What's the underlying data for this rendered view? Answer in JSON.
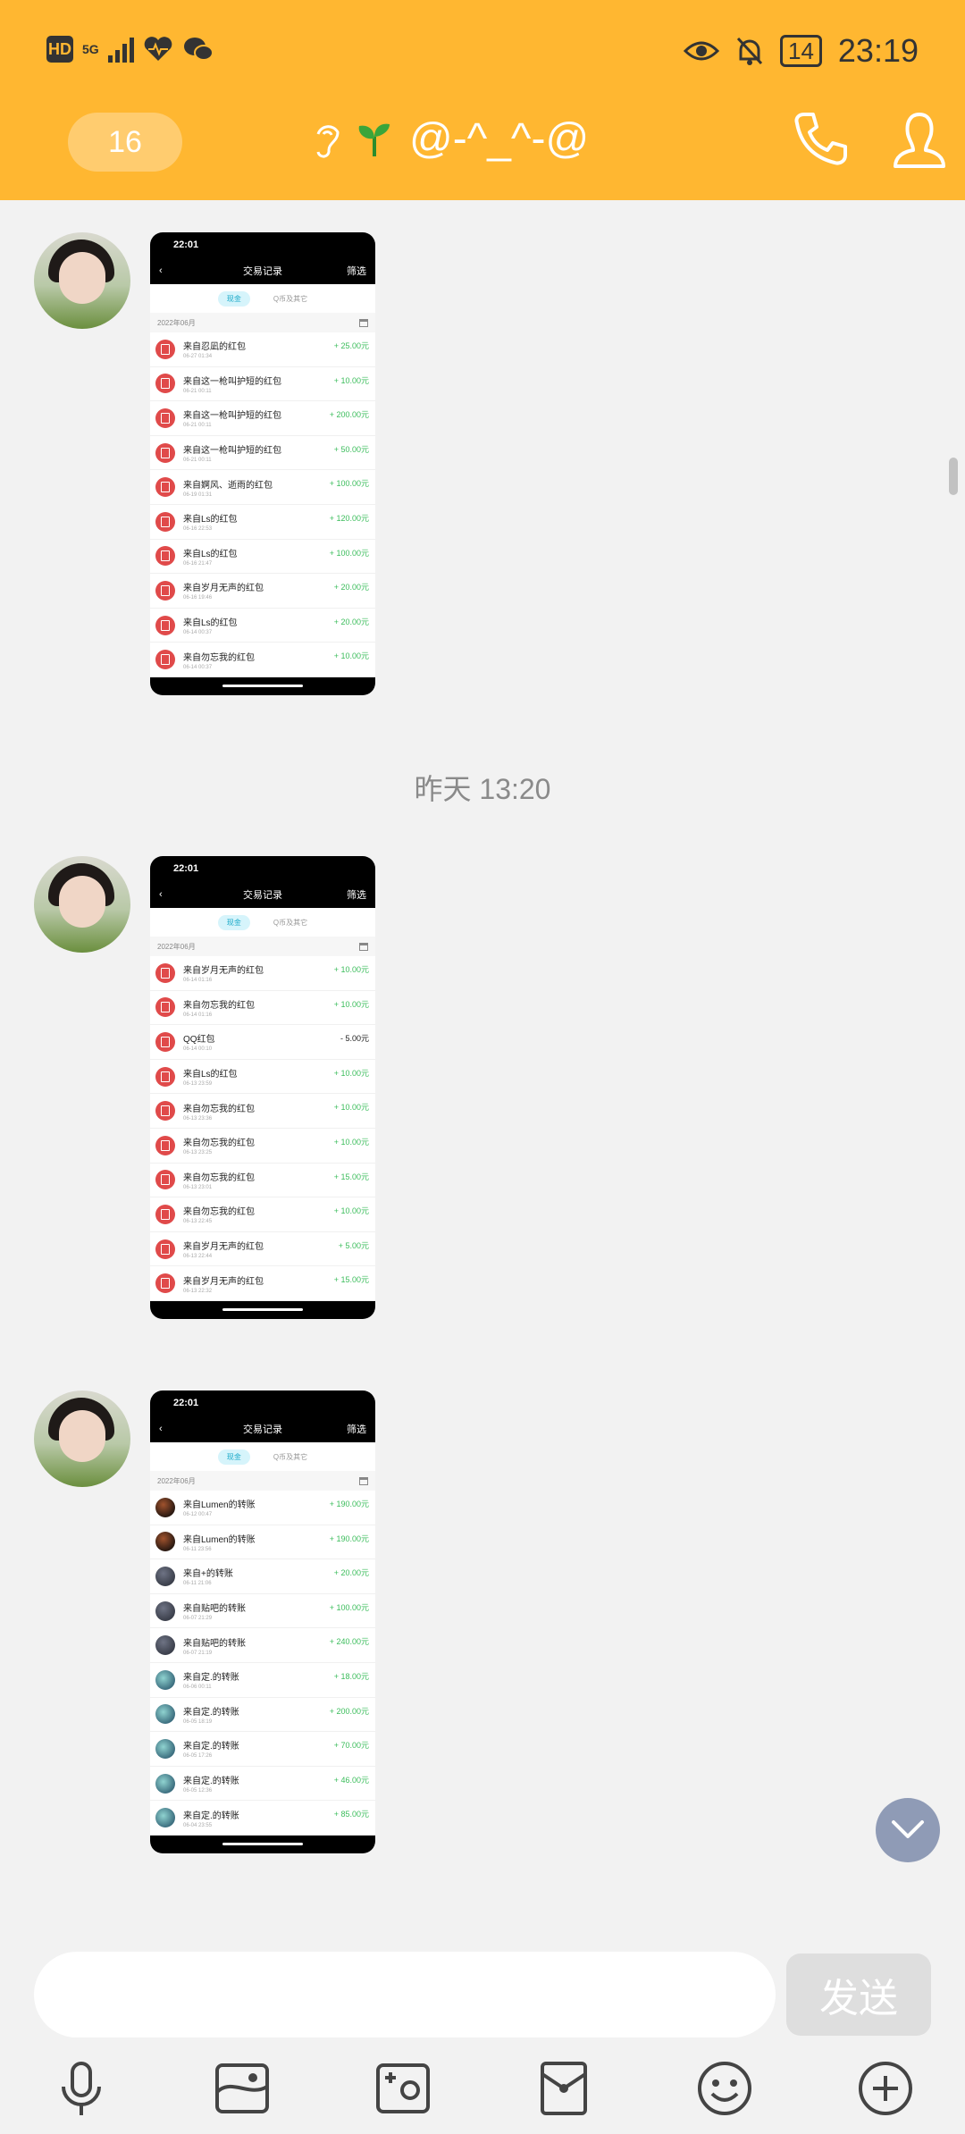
{
  "status_bar": {
    "hd": "HD",
    "network": "5G",
    "battery": "14",
    "time": "23:19"
  },
  "header": {
    "unread_count": "16",
    "contact_name": "@-^_^-@",
    "icons": [
      "ear-icon",
      "sprout-icon",
      "phone-icon",
      "profile-icon"
    ]
  },
  "timestamp": "昨天 13:20",
  "screenshots": [
    {
      "phone_time": "22:01",
      "nav_title": "交易记录",
      "filter": "筛选",
      "tab_active": "现金",
      "tab_other": "Q币及其它",
      "month": "2022年06月",
      "rows": [
        {
          "name": "来自忍凪的红包",
          "date": "06-27 01:34",
          "amount": "+ 25.00元",
          "icon": "red-packet"
        },
        {
          "name": "来自这一枪叫护短的红包",
          "date": "06-21 00:11",
          "amount": "+ 10.00元",
          "icon": "red-packet"
        },
        {
          "name": "来自这一枪叫护短的红包",
          "date": "06-21 00:11",
          "amount": "+ 200.00元",
          "icon": "red-packet"
        },
        {
          "name": "来自这一枪叫护短的红包",
          "date": "06-21 00:11",
          "amount": "+ 50.00元",
          "icon": "red-packet"
        },
        {
          "name": "来自婀风、逝雨的红包",
          "date": "06-19 01:31",
          "amount": "+ 100.00元",
          "icon": "red-packet"
        },
        {
          "name": "来自Ls的红包",
          "date": "06-16 22:53",
          "amount": "+ 120.00元",
          "icon": "red-packet"
        },
        {
          "name": "来自Ls的红包",
          "date": "06-16 21:47",
          "amount": "+ 100.00元",
          "icon": "red-packet"
        },
        {
          "name": "来自岁月无声的红包",
          "date": "06-16 19:46",
          "amount": "+ 20.00元",
          "icon": "red-packet"
        },
        {
          "name": "来自Ls的红包",
          "date": "06-14 00:37",
          "amount": "+ 20.00元",
          "icon": "red-packet"
        },
        {
          "name": "来自勿忘我的红包",
          "date": "06-14 00:37",
          "amount": "+ 10.00元",
          "icon": "red-packet"
        }
      ]
    },
    {
      "phone_time": "22:01",
      "nav_title": "交易记录",
      "filter": "筛选",
      "tab_active": "现金",
      "tab_other": "Q币及其它",
      "month": "2022年06月",
      "rows": [
        {
          "name": "来自岁月无声的红包",
          "date": "06-14 01:16",
          "amount": "+ 10.00元",
          "icon": "red-packet"
        },
        {
          "name": "来自勿忘我的红包",
          "date": "06-14 01:16",
          "amount": "+ 10.00元",
          "icon": "red-packet"
        },
        {
          "name": "QQ红包",
          "date": "06-14 00:10",
          "amount": "- 5.00元",
          "icon": "red-packet",
          "negative": true
        },
        {
          "name": "来自Ls的红包",
          "date": "06-13 23:59",
          "amount": "+ 10.00元",
          "icon": "red-packet"
        },
        {
          "name": "来自勿忘我的红包",
          "date": "06-13 23:36",
          "amount": "+ 10.00元",
          "icon": "red-packet"
        },
        {
          "name": "来自勿忘我的红包",
          "date": "06-13 23:25",
          "amount": "+ 10.00元",
          "icon": "red-packet"
        },
        {
          "name": "来自勿忘我的红包",
          "date": "06-13 23:01",
          "amount": "+ 15.00元",
          "icon": "red-packet"
        },
        {
          "name": "来自勿忘我的红包",
          "date": "06-13 22:45",
          "amount": "+ 10.00元",
          "icon": "red-packet"
        },
        {
          "name": "来自岁月无声的红包",
          "date": "06-13 22:44",
          "amount": "+ 5.00元",
          "icon": "red-packet"
        },
        {
          "name": "来自岁月无声的红包",
          "date": "06-13 22:32",
          "amount": "+ 15.00元",
          "icon": "red-packet"
        }
      ]
    },
    {
      "phone_time": "22:01",
      "nav_title": "交易记录",
      "filter": "筛选",
      "tab_active": "现金",
      "tab_other": "Q币及其它",
      "month": "2022年06月",
      "rows": [
        {
          "name": "来自Lumen的转账",
          "date": "06-12 00:47",
          "amount": "+ 190.00元",
          "icon": "p"
        },
        {
          "name": "来自Lumen的转账",
          "date": "06-11 23:56",
          "amount": "+ 190.00元",
          "icon": "p"
        },
        {
          "name": "来自+的转账",
          "date": "06-11 21:06",
          "amount": "+ 20.00元",
          "icon": "g"
        },
        {
          "name": "来自贴吧的转账",
          "date": "06-07 21:29",
          "amount": "+ 100.00元",
          "icon": "g"
        },
        {
          "name": "来自贴吧的转账",
          "date": "06-07 21:19",
          "amount": "+ 240.00元",
          "icon": "g"
        },
        {
          "name": "来自定.的转账",
          "date": "06-06 00:11",
          "amount": "+ 18.00元",
          "icon": "t"
        },
        {
          "name": "来自定.的转账",
          "date": "06-05 18:19",
          "amount": "+ 200.00元",
          "icon": "t"
        },
        {
          "name": "来自定.的转账",
          "date": "06-05 17:26",
          "amount": "+ 70.00元",
          "icon": "t"
        },
        {
          "name": "来自定.的转账",
          "date": "06-05 12:36",
          "amount": "+ 46.00元",
          "icon": "t"
        },
        {
          "name": "来自定.的转账",
          "date": "06-04 23:55",
          "amount": "+ 85.00元",
          "icon": "t"
        }
      ]
    }
  ],
  "composer": {
    "send_label": "发送",
    "toolbar_icons": [
      "microphone-icon",
      "image-icon",
      "camera-icon",
      "red-packet-icon",
      "emoji-icon",
      "plus-icon"
    ]
  },
  "colors": {
    "header": "#FFB731",
    "amount_positive": "#3cbd5c",
    "scroll_button": "#8f9bb6"
  }
}
